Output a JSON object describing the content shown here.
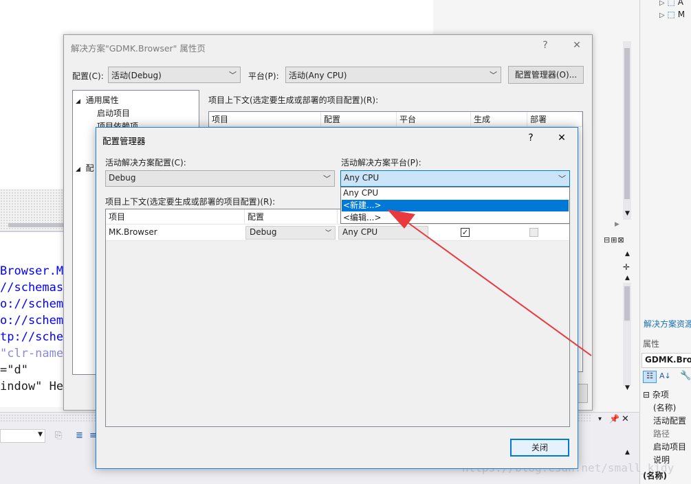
{
  "background_ide": {
    "code_lines": [
      {
        "text": "Browser.M",
        "color": "#0000ff"
      },
      {
        "text": "//schemas",
        "color": "#0000ff"
      },
      {
        "text": "o://schem",
        "color": "#0000ff"
      },
      {
        "text": "o://schem",
        "color": "#0000ff"
      },
      {
        "text": "tp://sche",
        "color": "#0000ff"
      },
      {
        "text": "\"clr-name",
        "color": "#8a8ad8"
      },
      {
        "text": "=\"d\"",
        "color": "#1e1e1e"
      },
      {
        "text": "indow\" He",
        "color": "#1e1e1e"
      }
    ],
    "right_panel": {
      "tree_item_a": "A",
      "tree_item_m": "M",
      "solution_explorer_tab": "解决方案资源",
      "properties_header": "属性",
      "properties_object": "GDMK.Brow",
      "category": "杂项",
      "props": [
        "(名称)",
        "活动配置",
        "路径",
        "启动项目",
        "说明"
      ],
      "bottom_label": "(名称)"
    },
    "watermark": "https://blog.csdn.net/small_kidy"
  },
  "property_dialog": {
    "title": "解决方案\"GDMK.Browser\" 属性页",
    "help": "?",
    "close": "✕",
    "config_label": "配置(C):",
    "config_value": "活动(Debug)",
    "platform_label": "平台(P):",
    "platform_value": "活动(Any CPU)",
    "config_manager_button": "配置管理器(O)...",
    "tree": {
      "root": "通用属性",
      "items": [
        "启动项目",
        "项目依赖项"
      ],
      "collapsed_item": "配"
    },
    "context_label": "项目上下文(选定要生成或部署的项目配置)(R):",
    "columns": [
      "项目",
      "配置",
      "平台",
      "生成",
      "部署"
    ]
  },
  "config_manager": {
    "title": "配置管理器",
    "help": "?",
    "close": "✕",
    "active_config_label": "活动解决方案配置(C):",
    "active_config_value": "Debug",
    "active_platform_label": "活动解决方案平台(P):",
    "active_platform_value": "Any CPU",
    "platform_options": [
      "Any CPU",
      "<新建...>",
      "<编辑...>"
    ],
    "selected_option_index": 1,
    "context_label": "项目上下文(选定要生成或部署的项目配置)(R):",
    "columns": [
      "项目",
      "配置"
    ],
    "row": {
      "project": "MK.Browser",
      "config": "Debug",
      "platform": "Any CPU",
      "build_checked": true,
      "deploy_checked": false,
      "check_mark": "✓"
    },
    "close_button": "关闭"
  },
  "annotation": {
    "arrow_color": "#e8393f"
  }
}
